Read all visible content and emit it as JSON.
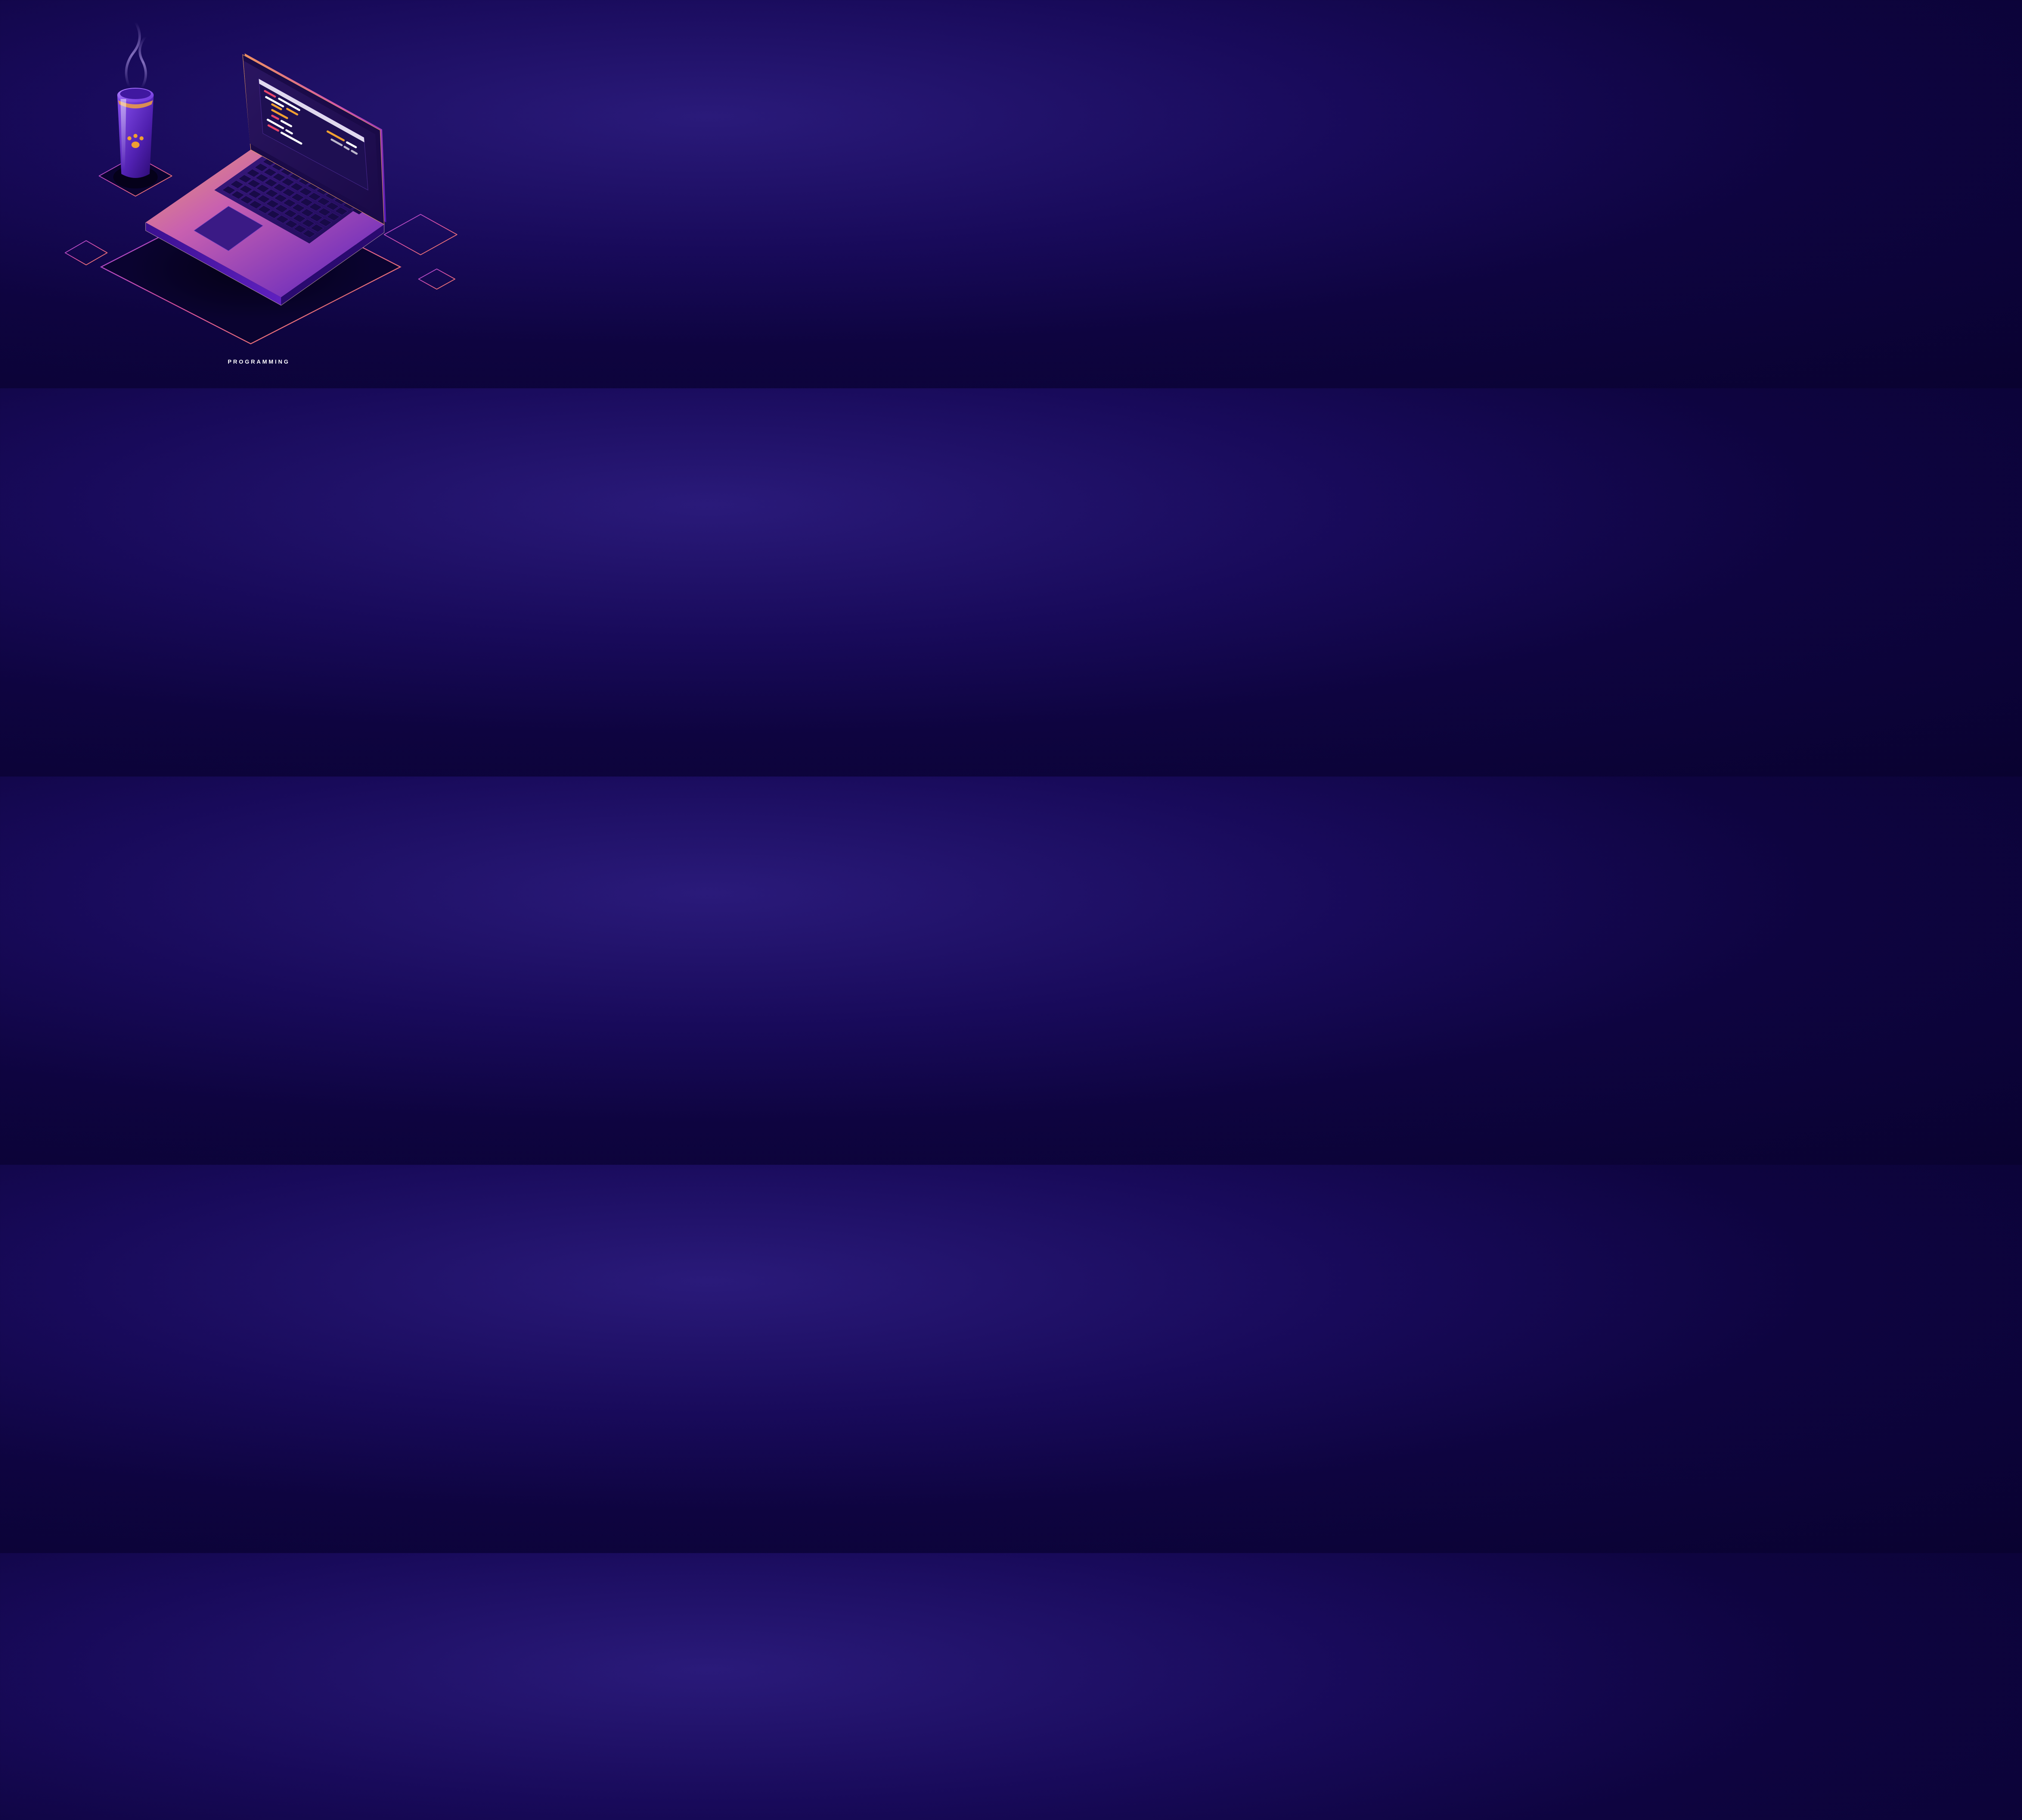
{
  "caption": "PROGRAMMING",
  "illustration": {
    "subject": "isometric-laptop-with-code-and-coffee",
    "coffee_cup_icon": "paw-print",
    "code_colors": [
      "#ffffff",
      "#f0a030",
      "#e8456a",
      "#c25590"
    ],
    "palette": {
      "bg_dark": "#0e0440",
      "bg_light": "#2a1a7a",
      "purple": "#6a30d8",
      "magenta": "#b840c8",
      "orange": "#f08040",
      "yellow": "#f0a030",
      "pink": "#e8456a"
    }
  }
}
